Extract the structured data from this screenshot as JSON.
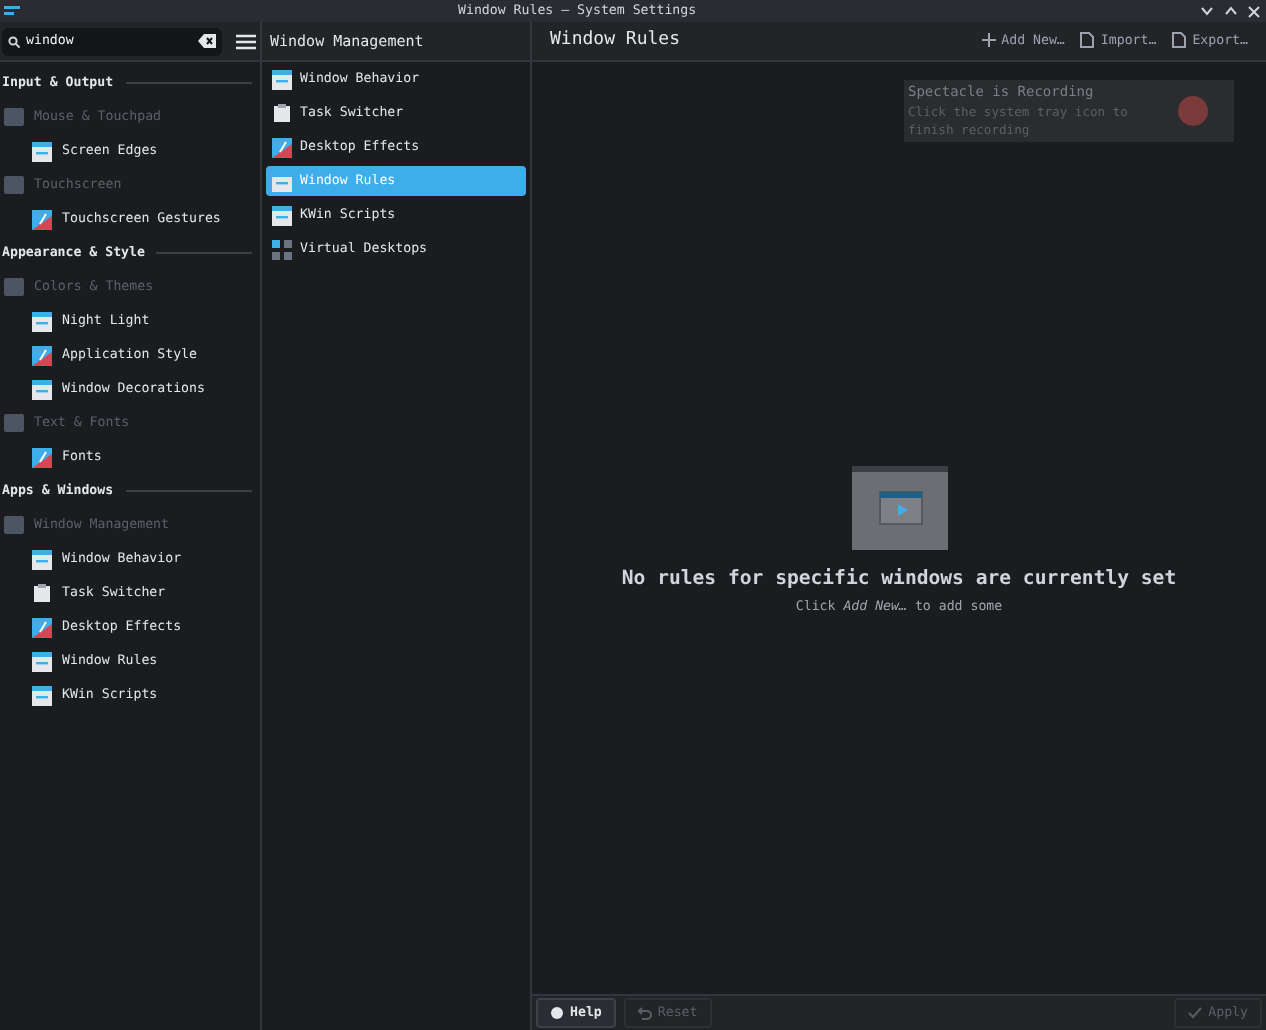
{
  "window": {
    "title": "Window Rules — System Settings"
  },
  "search": {
    "value": "window"
  },
  "sidebar": {
    "sections": [
      {
        "title": "Input & Output",
        "items": [
          {
            "label": "Mouse & Touchpad",
            "kind": "group",
            "children": [
              {
                "label": "Screen Edges",
                "kind": "item"
              }
            ]
          },
          {
            "label": "Touchscreen",
            "kind": "group",
            "children": [
              {
                "label": "Touchscreen Gestures",
                "kind": "item"
              }
            ]
          }
        ]
      },
      {
        "title": "Appearance & Style",
        "items": [
          {
            "label": "Colors & Themes",
            "kind": "group",
            "children": [
              {
                "label": "Night Light",
                "kind": "item"
              },
              {
                "label": "Application Style",
                "kind": "item"
              },
              {
                "label": "Window Decorations",
                "kind": "item"
              }
            ]
          },
          {
            "label": "Text & Fonts",
            "kind": "group",
            "children": [
              {
                "label": "Fonts",
                "kind": "item"
              }
            ]
          }
        ]
      },
      {
        "title": "Apps & Windows",
        "items": [
          {
            "label": "Window Management",
            "kind": "group",
            "children": [
              {
                "label": "Window Behavior",
                "kind": "item"
              },
              {
                "label": "Task Switcher",
                "kind": "item"
              },
              {
                "label": "Desktop Effects",
                "kind": "item"
              },
              {
                "label": "Window Rules",
                "kind": "item"
              },
              {
                "label": "KWin Scripts",
                "kind": "item"
              }
            ]
          }
        ]
      }
    ]
  },
  "subcategory": {
    "title": "Window Management",
    "items": [
      {
        "label": "Window Behavior",
        "selected": false
      },
      {
        "label": "Task Switcher",
        "selected": false
      },
      {
        "label": "Desktop Effects",
        "selected": false
      },
      {
        "label": "Window Rules",
        "selected": true
      },
      {
        "label": "KWin Scripts",
        "selected": false
      },
      {
        "label": "Virtual Desktops",
        "selected": false
      }
    ]
  },
  "page": {
    "title": "Window Rules",
    "toolbar": [
      "Add New…",
      "Import…",
      "Export…"
    ],
    "empty_title": "No rules for specific windows are currently set",
    "empty_hint": "Click *Add New…* to add some"
  },
  "notification": {
    "title": "Spectacle is Recording",
    "body": "Click the system tray icon to finish recording"
  },
  "footer": {
    "buttons": [
      {
        "label": "Help",
        "disabled": false
      },
      {
        "label": "Reset",
        "disabled": true
      },
      {
        "label": "Apply",
        "disabled": true
      }
    ]
  }
}
